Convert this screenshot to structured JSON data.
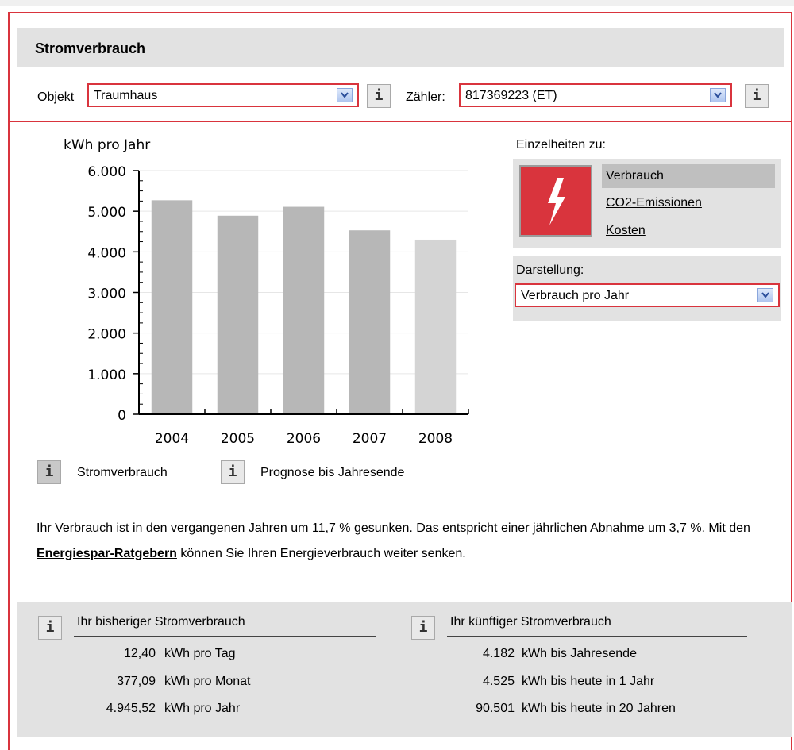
{
  "panel": {
    "title": "Stromverbrauch",
    "object_label": "Objekt",
    "object_value": "Traumhaus",
    "meter_label": "Zähler:",
    "meter_value": "817369223 (ET)",
    "info_glyph": "i"
  },
  "details": {
    "heading": "Einzelheiten zu:",
    "icon": "lightning-bolt-icon",
    "items": [
      {
        "label": "Verbrauch",
        "active": true
      },
      {
        "label": "CO2-Emissionen",
        "active": false
      },
      {
        "label": "Kosten",
        "active": false
      }
    ],
    "display_label": "Darstellung:",
    "display_value": "Verbrauch pro Jahr"
  },
  "legend": {
    "consumption": "Stromverbrauch",
    "forecast": "Prognose bis Jahresende"
  },
  "summary": {
    "text_before": "Ihr Verbrauch ist in den vergangenen Jahren um 11,7 % gesunken. Das entspricht einer jährlichen Abnahme um 3,7 %. Mit den ",
    "link": "Energiespar-Ratgebern",
    "text_after": " können Sie Ihren Energieverbrauch weiter senken."
  },
  "past": {
    "title": "Ihr bisheriger Stromverbrauch",
    "rows": [
      {
        "value": "12,40",
        "unit": "kWh pro Tag"
      },
      {
        "value": "377,09",
        "unit": "kWh pro Monat"
      },
      {
        "value": "4.945,52",
        "unit": "kWh pro Jahr"
      }
    ]
  },
  "future": {
    "title": "Ihr künftiger Stromverbrauch",
    "rows": [
      {
        "value": "4.182",
        "unit": "kWh bis Jahresende"
      },
      {
        "value": "4.525",
        "unit": "kWh bis heute in 1 Jahr"
      },
      {
        "value": "90.501",
        "unit": "kWh bis heute in 20 Jahren"
      }
    ]
  },
  "colors": {
    "accent": "#d9343d",
    "bar": "#b7b7b7",
    "bar_forecast": "#d4d4d4",
    "panel_bg": "#e2e2e2"
  },
  "chart_data": {
    "type": "bar",
    "ylabel": "kWh pro Jahr",
    "categories": [
      "2004",
      "2005",
      "2006",
      "2007",
      "2008"
    ],
    "values": [
      5270,
      4890,
      5110,
      4530,
      4300
    ],
    "forecast": [
      false,
      false,
      false,
      false,
      true
    ],
    "ylim": [
      0,
      6000
    ],
    "yticks": [
      0,
      1000,
      2000,
      3000,
      4000,
      5000,
      6000
    ],
    "ytick_labels": [
      "0",
      "1.000",
      "2.000",
      "3.000",
      "4.000",
      "5.000",
      "6.000"
    ],
    "grid": true
  }
}
